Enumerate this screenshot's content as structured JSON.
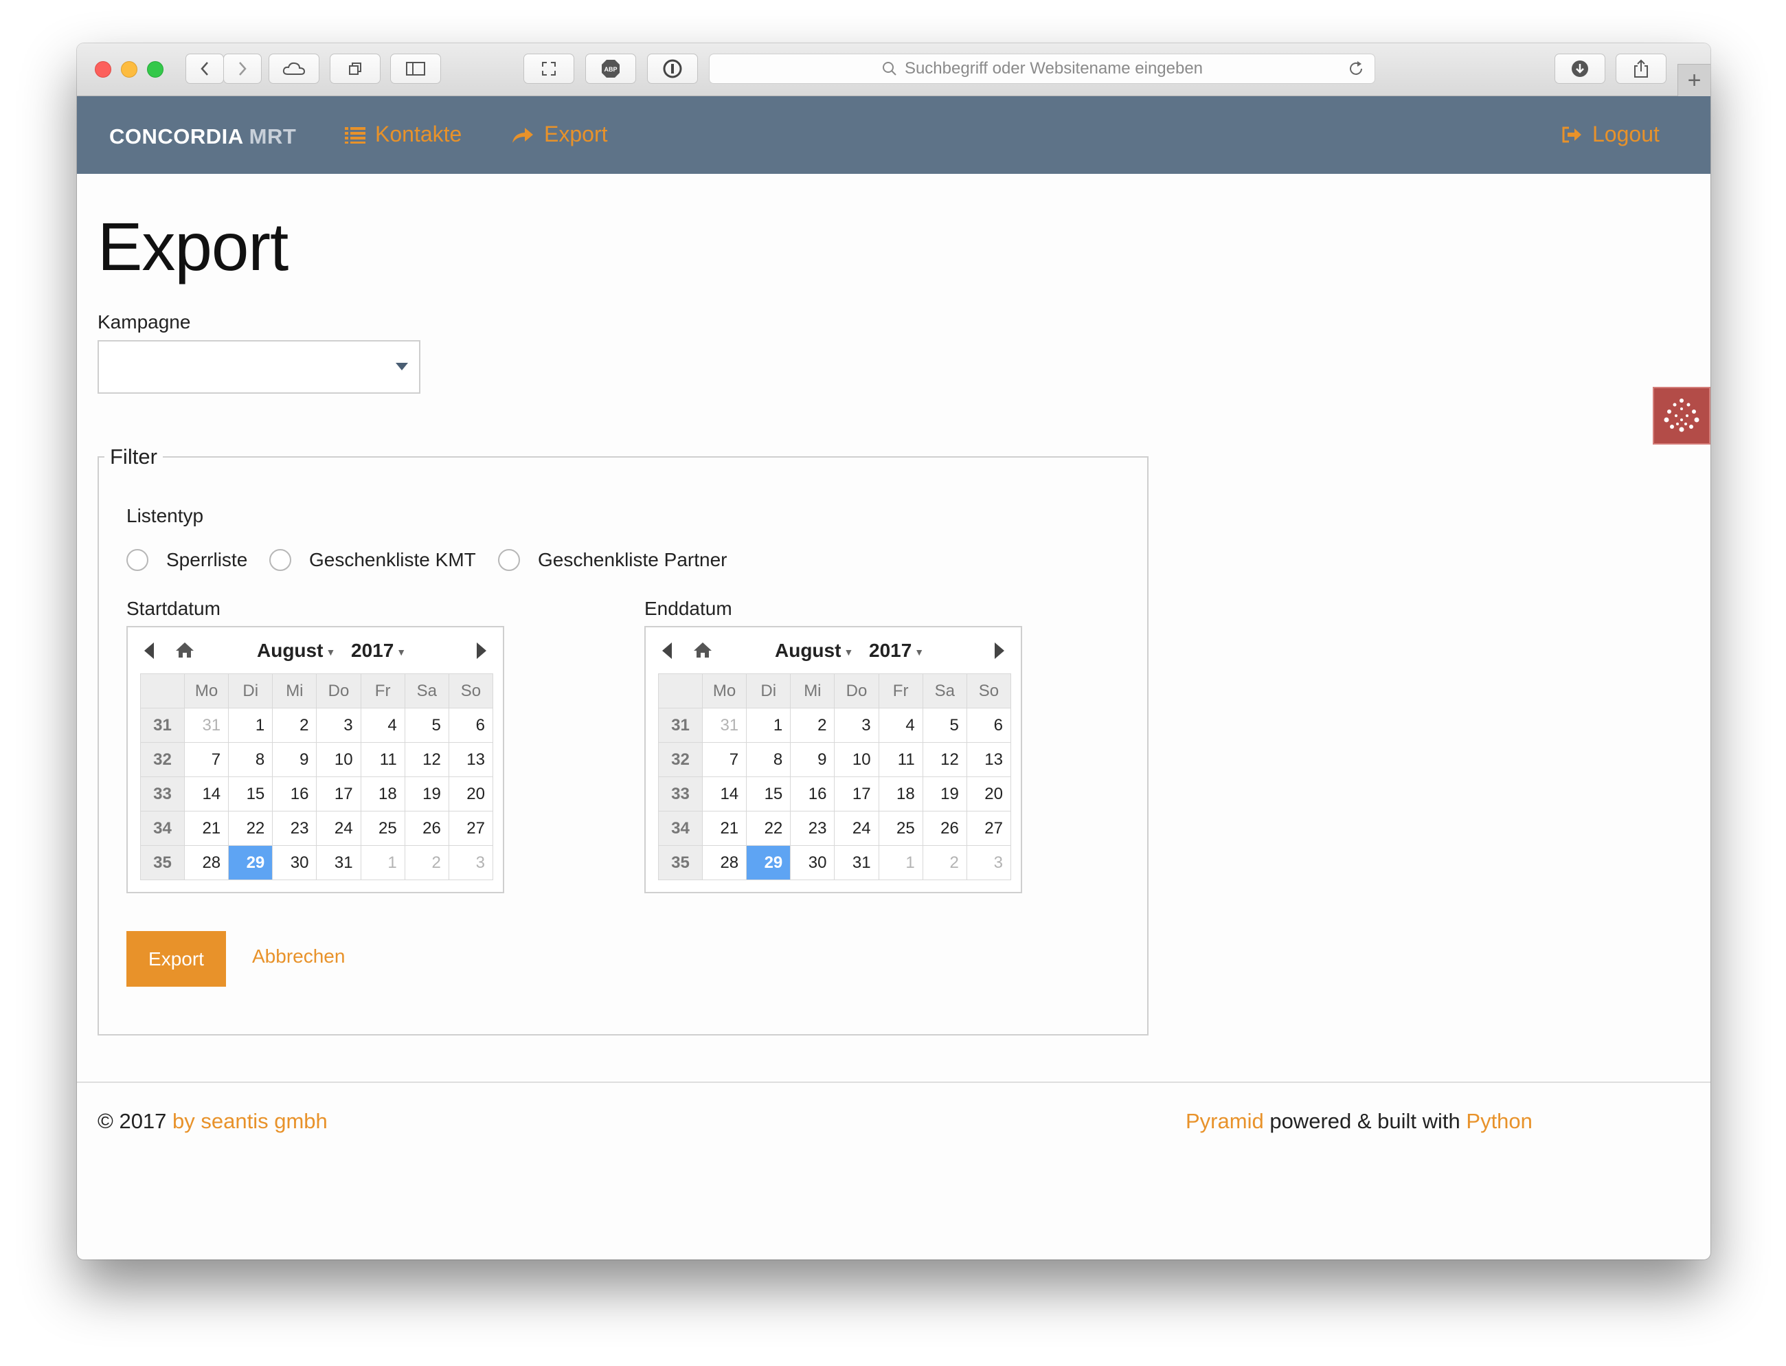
{
  "browser": {
    "url_placeholder": "Suchbegriff oder Websitename eingeben",
    "new_tab_label": "+"
  },
  "navbar": {
    "brand_main": "CONCORDIA",
    "brand_sub": "MRT",
    "links": [
      {
        "label": "Kontakte",
        "icon": "list-icon"
      },
      {
        "label": "Export",
        "icon": "share-arrow-icon"
      }
    ],
    "logout_label": "Logout",
    "accent_color": "#e8922a",
    "bg_color": "#5e7388"
  },
  "page": {
    "title": "Export",
    "campaign_label": "Kampagne",
    "campaign_value": ""
  },
  "filter": {
    "legend": "Filter",
    "list_type_label": "Listentyp",
    "options": [
      "Sperrliste",
      "Geschenkliste KMT",
      "Geschenkliste Partner"
    ],
    "start_label": "Startdatum",
    "end_label": "Enddatum"
  },
  "calendar": {
    "month": "August",
    "year": "2017",
    "weekdays": [
      "Mo",
      "Di",
      "Mi",
      "Do",
      "Fr",
      "Sa",
      "So"
    ],
    "weeks": [
      {
        "week": "31",
        "days": [
          "31",
          "1",
          "2",
          "3",
          "4",
          "5",
          "6"
        ]
      },
      {
        "week": "32",
        "days": [
          "7",
          "8",
          "9",
          "10",
          "11",
          "12",
          "13"
        ]
      },
      {
        "week": "33",
        "days": [
          "14",
          "15",
          "16",
          "17",
          "18",
          "19",
          "20"
        ]
      },
      {
        "week": "34",
        "days": [
          "21",
          "22",
          "23",
          "24",
          "25",
          "26",
          "27"
        ]
      },
      {
        "week": "35",
        "days": [
          "28",
          "29",
          "30",
          "31",
          "1",
          "2",
          "3"
        ]
      }
    ],
    "selected_day": "29",
    "selected_color": "#5ea4f3"
  },
  "actions": {
    "export_label": "Export",
    "cancel_label": "Abbrechen"
  },
  "footer": {
    "copyright": "© 2017",
    "company_link": "by seantis gmbh",
    "pyramid_link": "Pyramid",
    "middle_text": "powered & built with",
    "python_link": "Python"
  }
}
